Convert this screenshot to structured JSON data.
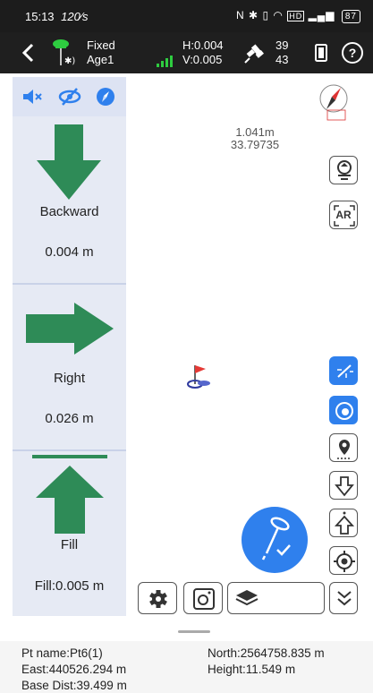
{
  "status_bar": {
    "time": "15:13",
    "speed": "120⁄s",
    "battery": "87"
  },
  "header": {
    "fix_status": "Fixed",
    "age": "Age1",
    "h_precision": "H:0.004",
    "v_precision": "V:0.005",
    "satellites_used": "39",
    "satellites_visible": "43"
  },
  "left_panel": {
    "sections": [
      {
        "label": "Backward",
        "value": "0.004 m"
      },
      {
        "label": "Right",
        "value": "0.026 m"
      },
      {
        "label": "Fill",
        "value": "Fill:0.005 m"
      }
    ]
  },
  "map": {
    "distance": "1.041m",
    "bearing": "33.79735",
    "ar_button_label": "AR"
  },
  "info_panel": {
    "pt_name": "Pt name:Pt6(1)",
    "north": "North:2564758.835 m",
    "east": "East:440526.294 m",
    "height": "Height:11.549 m",
    "base_dist": "Base Dist:39.499 m"
  },
  "colors": {
    "arrow_green": "#2e8b57",
    "accent_blue": "#2f80ed",
    "panel_bg": "#e6eaf4"
  }
}
